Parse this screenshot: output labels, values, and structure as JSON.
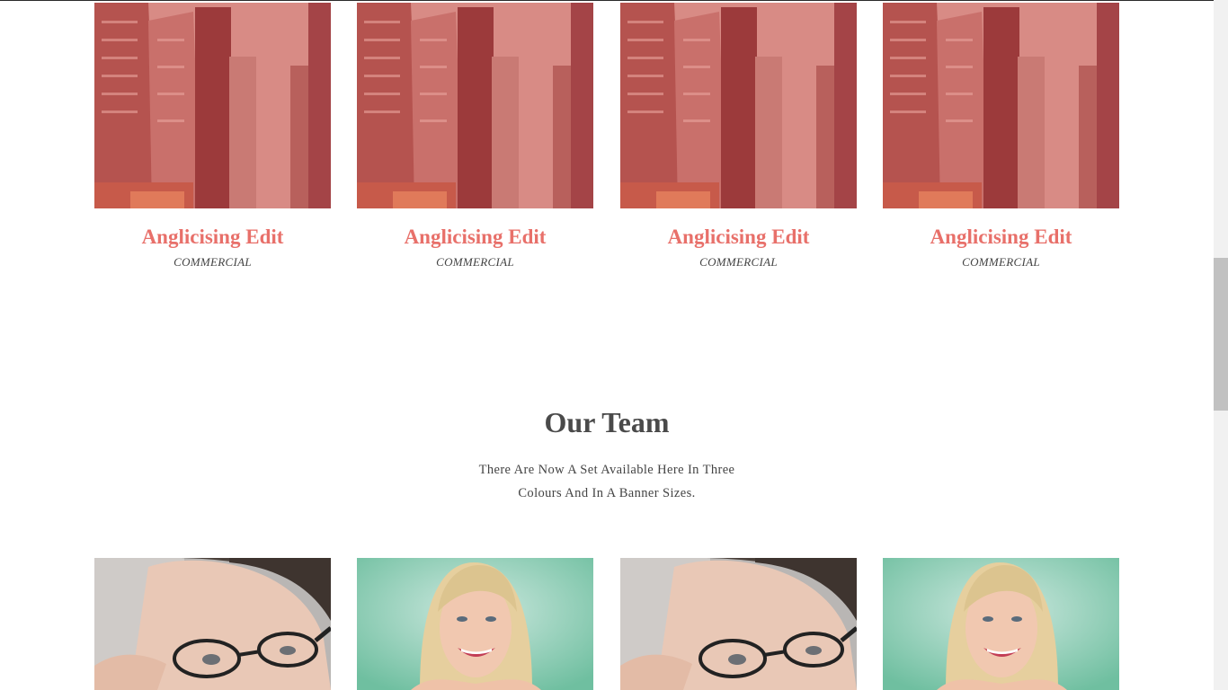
{
  "portfolio": {
    "items": [
      {
        "title": "Anglicising Edit",
        "category": "COMMERCIAL",
        "image": "city-street-photo"
      },
      {
        "title": "Anglicising Edit",
        "category": "COMMERCIAL",
        "image": "city-street-photo"
      },
      {
        "title": "Anglicising Edit",
        "category": "COMMERCIAL",
        "image": "city-street-photo"
      },
      {
        "title": "Anglicising Edit",
        "category": "COMMERCIAL",
        "image": "city-street-photo"
      }
    ],
    "overlay_color": "#e8706a"
  },
  "team": {
    "heading": "Our Team",
    "subtitle_line1": "There Are Now A Set Available Here In Three",
    "subtitle_line2": "Colours And In A Banner Sizes.",
    "members": [
      {
        "photo": "woman-with-glasses-photo"
      },
      {
        "photo": "smiling-blonde-woman-photo"
      },
      {
        "photo": "woman-with-glasses-photo"
      },
      {
        "photo": "smiling-blonde-woman-photo"
      }
    ]
  },
  "colors": {
    "accent": "#e8706a",
    "heading": "#4a4a4a",
    "text": "#444444"
  }
}
